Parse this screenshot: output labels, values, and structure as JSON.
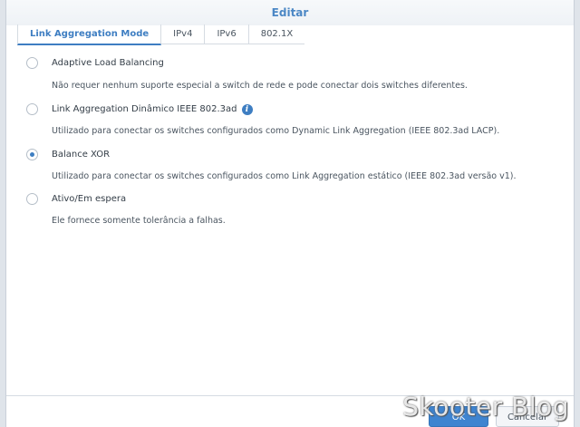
{
  "window": {
    "title": "Editar"
  },
  "tabs": [
    {
      "label": "Link Aggregation Mode",
      "active": true
    },
    {
      "label": "IPv4"
    },
    {
      "label": "IPv6"
    },
    {
      "label": "802.1X"
    }
  ],
  "options": [
    {
      "label": "Adaptive Load Balancing",
      "description": "Não requer nenhum suporte especial a switch de rede e pode conectar dois switches diferentes.",
      "selected": false
    },
    {
      "label": "Link Aggregation Dinâmico IEEE 802.3ad",
      "description": "Utilizado para conectar os switches configurados como Dynamic Link Aggregation (IEEE 802.3ad LACP).",
      "selected": false,
      "info_icon": "i"
    },
    {
      "label": "Balance XOR",
      "description": "Utilizado para conectar os switches configurados como Link Aggregation estático (IEEE 802.3ad versão v1).",
      "selected": true
    },
    {
      "label": "Ativo/Em espera",
      "description": "Ele fornece somente tolerância a falhas.",
      "selected": false
    }
  ],
  "footer": {
    "ok_label": "OK",
    "cancel_label": "Cancelar"
  },
  "watermark": "Skooter Blog",
  "colors": {
    "accent": "#3e7ec2",
    "title": "#4b87c5"
  }
}
